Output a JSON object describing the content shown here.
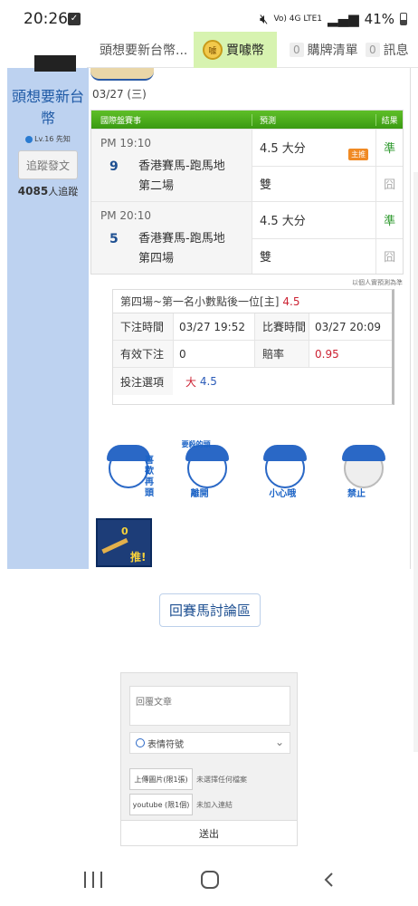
{
  "status_bar": {
    "time": "20:26",
    "right_text": "41%",
    "sig_text": "Vo) 4G\nLTE1"
  },
  "tabs": {
    "title": "頭想要新台幣...",
    "coin_tab": "買噱幣",
    "coin_icon_text": "噱",
    "cart": {
      "count": "0",
      "label": "購牌清單"
    },
    "msg": {
      "count": "0",
      "label": "訊息"
    }
  },
  "profile": {
    "name": "頭想要新台幣",
    "level": "Lv.16 先知",
    "follow_button": "追蹤發文",
    "follower_count": "4085",
    "follower_suffix": "人追蹤"
  },
  "post": {
    "date": "03/27 (三)",
    "table_headers": {
      "event": "國際盤賽事",
      "prediction": "預測",
      "result": "結果"
    },
    "games": [
      {
        "time": "PM 19:10",
        "num": "9",
        "name_line1": "香港賽馬-跑馬地",
        "name_line2": "第二場",
        "pred1": "4.5 大分",
        "pred1_tag": "主推",
        "result1": "準",
        "pred2": "雙",
        "result2": "囧"
      },
      {
        "time": "PM 20:10",
        "num": "5",
        "name_line1": "香港賽馬-跑馬地",
        "name_line2": "第四場",
        "pred1": "4.5 大分",
        "pred1_tag": "",
        "result1": "準",
        "pred2": "雙",
        "result2": "囧"
      }
    ],
    "note": "以個人實預測為準"
  },
  "bet": {
    "title": "第四場~第一名小數點後一位[主]",
    "title_value": "4.5",
    "order_time_label": "下注時間",
    "order_time": "03/27 19:52",
    "match_time_label": "比賽時間",
    "match_time": "03/27 20:09",
    "valid_label": "有效下注",
    "valid": "0",
    "odds_label": "賠率",
    "odds": "0.95",
    "option_label": "投注選項",
    "option_text": "大",
    "option_value": "4.5"
  },
  "stickers": [
    {
      "side_text": "喜歡再頭",
      "bottom_text": ""
    },
    {
      "side_text": "要殺的頭",
      "bottom_text": "離開"
    },
    {
      "side_text": "",
      "bottom_text": "小心哦"
    },
    {
      "side_text": "",
      "bottom_text": "禁止"
    }
  ],
  "push": {
    "count": "0",
    "label": "推!"
  },
  "back_button": "回賽馬討論區",
  "reply": {
    "placeholder": "回覆文章",
    "emoji_label": "表情符號",
    "upload_button": "上傳圖片(限1張)",
    "upload_status": "未選擇任何檔案",
    "youtube_button": "youtube (限1個)",
    "youtube_status": "未加入連結",
    "submit": "送出"
  }
}
